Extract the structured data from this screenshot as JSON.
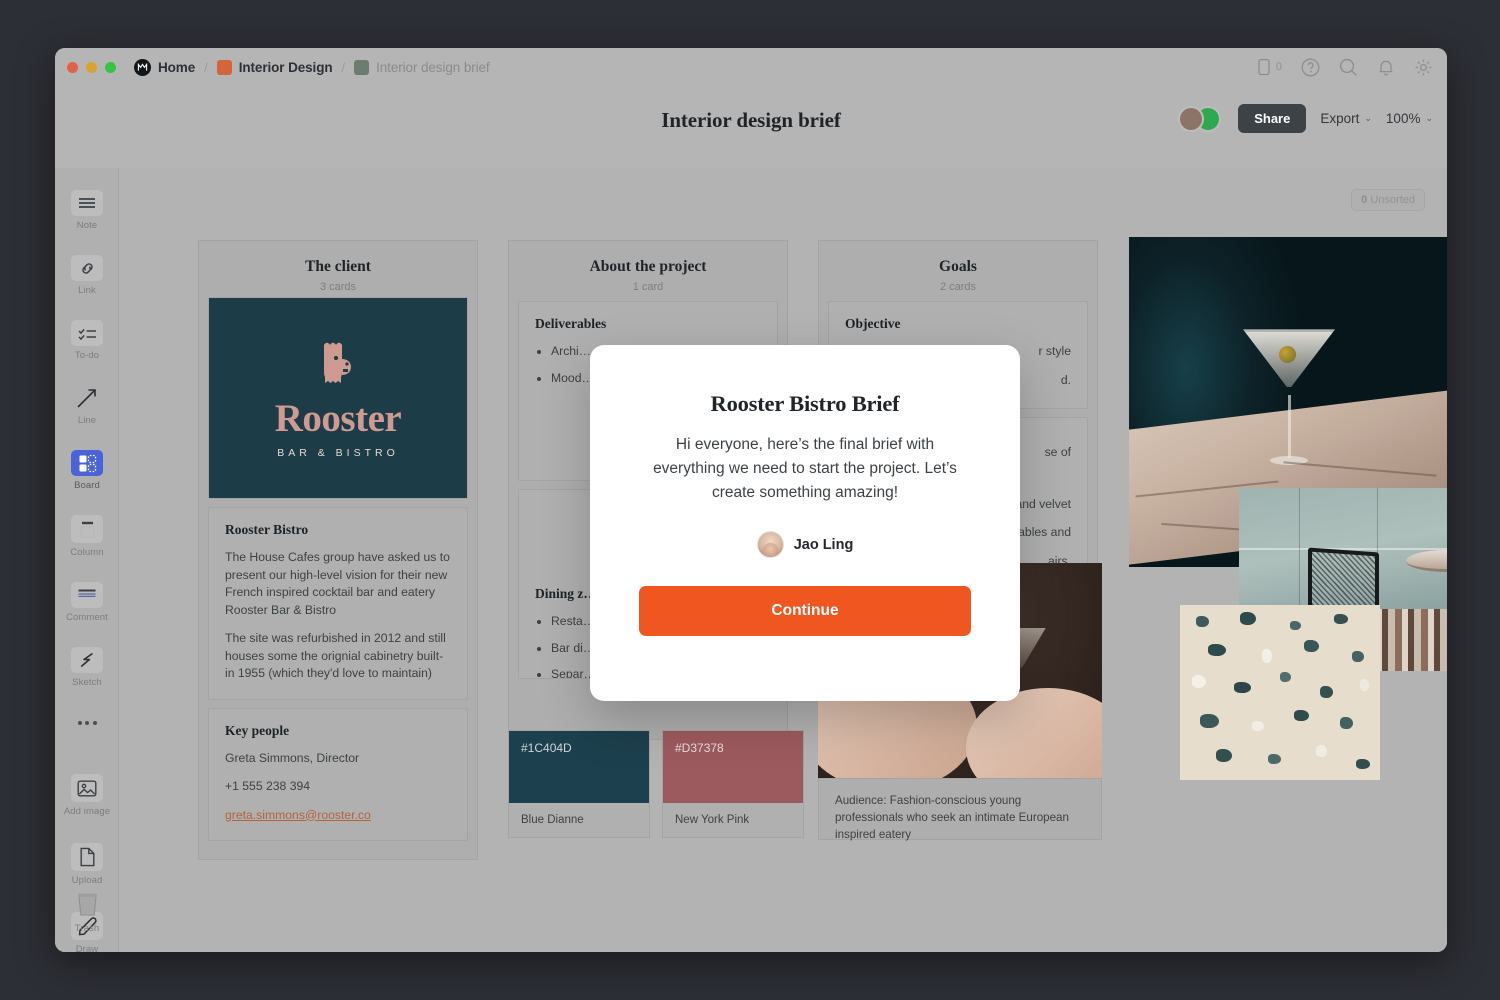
{
  "window": {
    "titlebar": {
      "breadcrumbs": [
        {
          "label": "Home",
          "icon": "app-logo-icon",
          "muted": false
        },
        {
          "label": "Interior Design",
          "icon": "orange-square-icon",
          "muted": false
        },
        {
          "label": "Interior design brief",
          "icon": "green-square-icon",
          "muted": true
        }
      ],
      "separator": "/",
      "right_icons": [
        {
          "name": "mobile-preview-icon",
          "badge": "0"
        },
        {
          "name": "help-icon"
        },
        {
          "name": "search-icon"
        },
        {
          "name": "notifications-bell-icon"
        },
        {
          "name": "settings-gear-icon"
        }
      ]
    },
    "header": {
      "title": "Interior design brief",
      "share_label": "Share",
      "export_label": "Export",
      "zoom_label": "100%",
      "caret": "⌄"
    }
  },
  "toolbar": {
    "tools": [
      {
        "label": "Note",
        "icon": "note-lines-icon",
        "active": false
      },
      {
        "label": "Link",
        "icon": "link-chain-icon",
        "active": false
      },
      {
        "label": "To-do",
        "icon": "checklist-icon",
        "active": false
      },
      {
        "label": "Line",
        "icon": "arrow-line-icon",
        "active": false
      },
      {
        "label": "Board",
        "icon": "board-grid-icon",
        "active": true
      },
      {
        "label": "Column",
        "icon": "column-icon",
        "active": false
      },
      {
        "label": "Comment",
        "icon": "comment-bubble-icon",
        "active": false
      },
      {
        "label": "Sketch",
        "icon": "sketch-scribble-icon",
        "active": false
      },
      {
        "label": "",
        "icon": "more-dots-icon",
        "active": false
      },
      {
        "label": "Add image",
        "icon": "image-icon",
        "active": false
      },
      {
        "label": "Upload",
        "icon": "file-upload-icon",
        "active": false
      },
      {
        "label": "Draw",
        "icon": "pencil-draw-icon",
        "active": false
      }
    ],
    "trash_label": "Trash"
  },
  "canvas": {
    "unsorted_count": "0",
    "unsorted_label": "Unsorted",
    "groups": [
      {
        "title": "The client",
        "subtitle": "3 cards",
        "logo": {
          "word": "Rooster",
          "sub": "BAR & BISTRO",
          "bg": "#1C3C47",
          "fg": "#CF9A91"
        },
        "cards": [
          {
            "heading": "Rooster Bistro",
            "paragraphs": [
              "The House Cafes group have asked us to present our high-level vision for their new French inspired cocktail bar and eatery Rooster Bar & Bistro",
              "The site was refurbished in 2012 and still houses some the orignial cabinetry built-in 1955 (which they'd love to maintain)"
            ]
          },
          {
            "heading": "Key people",
            "paragraphs": [
              "Greta Simmons, Director",
              "+1 555 238 394"
            ],
            "email": "greta.simmons@rooster.co"
          }
        ]
      },
      {
        "title": "About the project",
        "subtitle": "1 card",
        "cards": [
          {
            "heading": "Deliverables",
            "bullets": [
              "Archi… of the… court… buildi…",
              "Mood… prima…"
            ]
          },
          {
            "heading": "Dining z…",
            "bullets": [
              "Resta…",
              "Bar di…",
              "Separ… court…"
            ]
          }
        ],
        "swatches": [
          {
            "hex": "#1C404D",
            "name": "Blue Dianne"
          },
          {
            "hex": "#D37378",
            "name": "New York Pink"
          }
        ]
      },
      {
        "title": "Goals",
        "subtitle": "2 cards",
        "cards": [
          {
            "heading": "Objective",
            "fragments": [
              "r style",
              "d."
            ]
          },
          {
            "heading": "",
            "fragments": [
              "se of",
              "and velvet",
              "ables and",
              "airs."
            ]
          }
        ],
        "caption": "Audience: Fashion-conscious young professionals who seek an intimate European inspired eatery"
      }
    ],
    "images": [
      {
        "name": "martini-cocktail-photo"
      },
      {
        "name": "cafe-interior-chair-photo"
      },
      {
        "name": "terrazzo-texture-photo"
      },
      {
        "name": "cheers-toast-photo"
      }
    ]
  },
  "modal": {
    "title": "Rooster Bistro Brief",
    "body": "Hi everyone, here’s the final brief with everything we need to start the project. Let’s create something amazing!",
    "author": "Jao Ling",
    "cta": "Continue",
    "cta_color": "#EF5620"
  }
}
